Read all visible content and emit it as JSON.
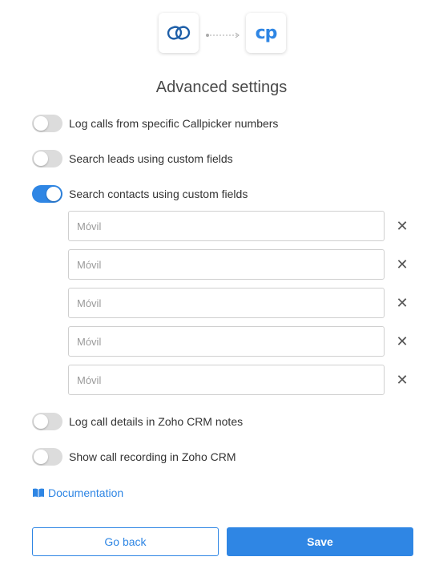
{
  "header": {
    "source_app_icon": "zoho-crm-logo-icon",
    "target_app_logo_text": "cp",
    "title": "Advanced settings"
  },
  "toggles": [
    {
      "label": "Log calls from specific Callpicker numbers",
      "on": false
    },
    {
      "label": "Search leads using custom fields",
      "on": false
    },
    {
      "label": "Search contacts using custom fields",
      "on": true
    }
  ],
  "custom_fields": [
    {
      "placeholder": "Móvil",
      "value": ""
    },
    {
      "placeholder": "Móvil",
      "value": ""
    },
    {
      "placeholder": "Móvil",
      "value": ""
    },
    {
      "placeholder": "Móvil",
      "value": ""
    },
    {
      "placeholder": "Móvil",
      "value": ""
    }
  ],
  "remove_symbol": "✕",
  "toggles_after": [
    {
      "label": "Log call details in Zoho CRM notes",
      "on": false
    },
    {
      "label": "Show call recording in Zoho CRM",
      "on": false
    }
  ],
  "documentation_link": "Documentation",
  "buttons": {
    "back": "Go back",
    "save": "Save"
  },
  "colors": {
    "accent": "#2f86e4",
    "toggle_off": "#dcdcdc"
  }
}
